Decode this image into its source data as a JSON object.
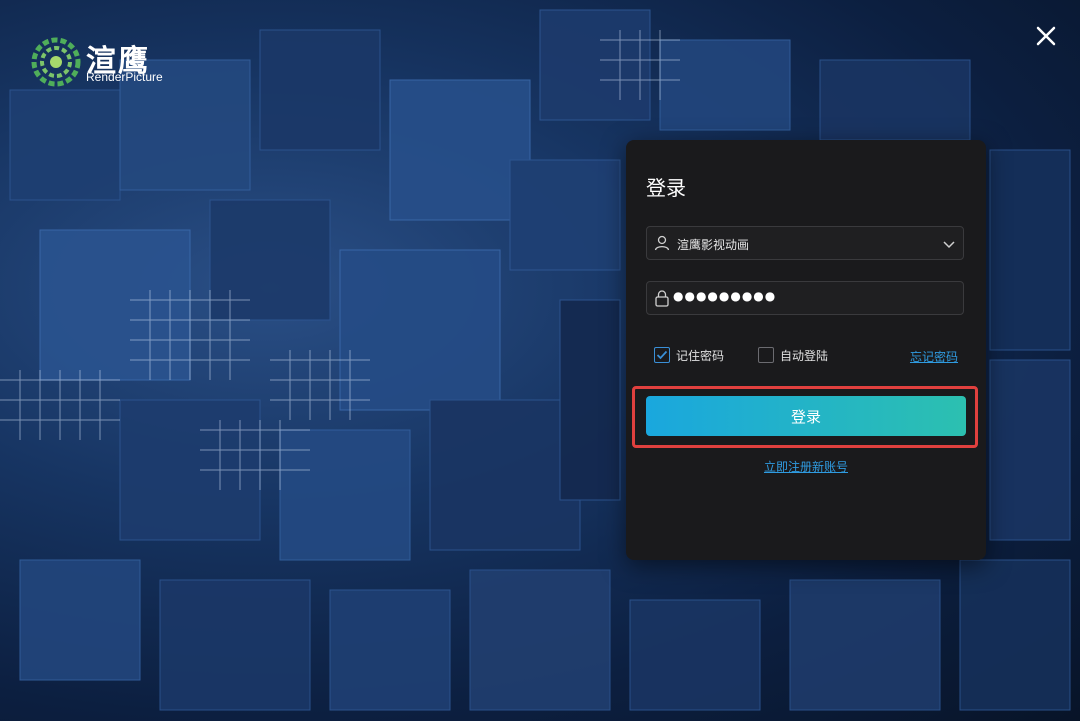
{
  "brand": {
    "name_cn": "渲鹰",
    "name_en": "RenderPicture",
    "logo_icon": "render-picture-globe-logo"
  },
  "window": {
    "close_icon": "close-icon"
  },
  "login": {
    "title": "登录",
    "username": {
      "value": "渲鹰影视动画",
      "icon": "user-icon",
      "dropdown_icon": "chevron-down-icon"
    },
    "password": {
      "masked_value": "●●●●●●●●●",
      "icon": "lock-icon"
    },
    "remember_password": {
      "label": "记住密码",
      "checked": true
    },
    "auto_login": {
      "label": "自动登陆",
      "checked": false
    },
    "forgot_password": "忘记密码",
    "submit_label": "登录",
    "register_link": "立即注册新账号"
  },
  "colors": {
    "accent_start": "#1aa7de",
    "accent_end": "#2cc0b0",
    "link": "#2f9be0",
    "highlight": "#e0403e",
    "panel_bg": "#1a1a1c"
  }
}
